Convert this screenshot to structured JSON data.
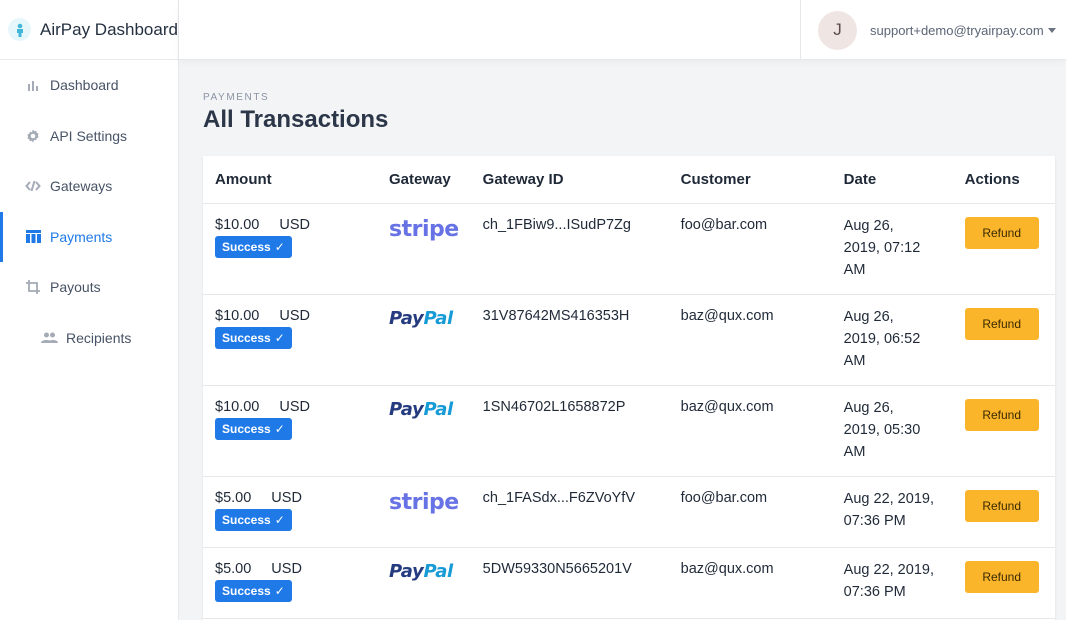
{
  "brand": {
    "title": "AirPay Dashboard",
    "logo_icon": "person-logo-icon"
  },
  "nav": {
    "items": [
      {
        "label": "Dashboard",
        "icon": "bar-chart-icon",
        "active": false
      },
      {
        "label": "API Settings",
        "icon": "gear-icon",
        "active": false
      },
      {
        "label": "Gateways",
        "icon": "link-icon",
        "active": false
      },
      {
        "label": "Payments",
        "icon": "table-icon",
        "active": true
      },
      {
        "label": "Payouts",
        "icon": "crop-icon",
        "active": false
      },
      {
        "label": "Recipients",
        "icon": "people-icon",
        "active": false
      }
    ]
  },
  "header": {
    "avatar_initial": "J",
    "user_email": "support+demo@tryairpay.com"
  },
  "page": {
    "eyebrow": "PAYMENTS",
    "title": "All Transactions"
  },
  "table": {
    "headers": [
      "Amount",
      "Gateway",
      "Gateway ID",
      "Customer",
      "Date",
      "Actions"
    ],
    "rows": [
      {
        "amount": "$10.00",
        "currency": "USD",
        "status": "Success",
        "gateway": "stripe",
        "gateway_id": "ch_1FBiw9...ISudP7Zg",
        "customer": "foo@bar.com",
        "date_line1": "Aug 26,",
        "date_line2": "2019, 07:12",
        "date_line3": "AM",
        "action": "Refund"
      },
      {
        "amount": "$10.00",
        "currency": "USD",
        "status": "Success",
        "gateway": "paypal",
        "gateway_id": "31V87642MS416353H",
        "customer": "baz@qux.com",
        "date_line1": "Aug 26,",
        "date_line2": "2019, 06:52",
        "date_line3": "AM",
        "action": "Refund"
      },
      {
        "amount": "$10.00",
        "currency": "USD",
        "status": "Success",
        "gateway": "paypal",
        "gateway_id": "1SN46702L1658872P",
        "customer": "baz@qux.com",
        "date_line1": "Aug 26,",
        "date_line2": "2019, 05:30",
        "date_line3": "AM",
        "action": "Refund"
      },
      {
        "amount": "$5.00",
        "currency": "USD",
        "status": "Success",
        "gateway": "stripe",
        "gateway_id": "ch_1FASdx...F6ZVoYfV",
        "customer": "foo@bar.com",
        "date_line1": "Aug 22, 2019,",
        "date_line2": "07:36 PM",
        "date_line3": "",
        "action": "Refund"
      },
      {
        "amount": "$5.00",
        "currency": "USD",
        "status": "Success",
        "gateway": "paypal",
        "gateway_id": "5DW59330N5665201V",
        "customer": "baz@qux.com",
        "date_line1": "Aug 22, 2019,",
        "date_line2": "07:36 PM",
        "date_line3": "",
        "action": "Refund"
      }
    ]
  },
  "logos": {
    "stripe": "stripe",
    "paypal_a": "Pay",
    "paypal_b": "Pal"
  },
  "colors": {
    "accent": "#1f7ae8",
    "refund": "#fbb52b",
    "stripe": "#6772e5",
    "paypal_dark": "#253b80",
    "paypal_light": "#179bd7"
  }
}
